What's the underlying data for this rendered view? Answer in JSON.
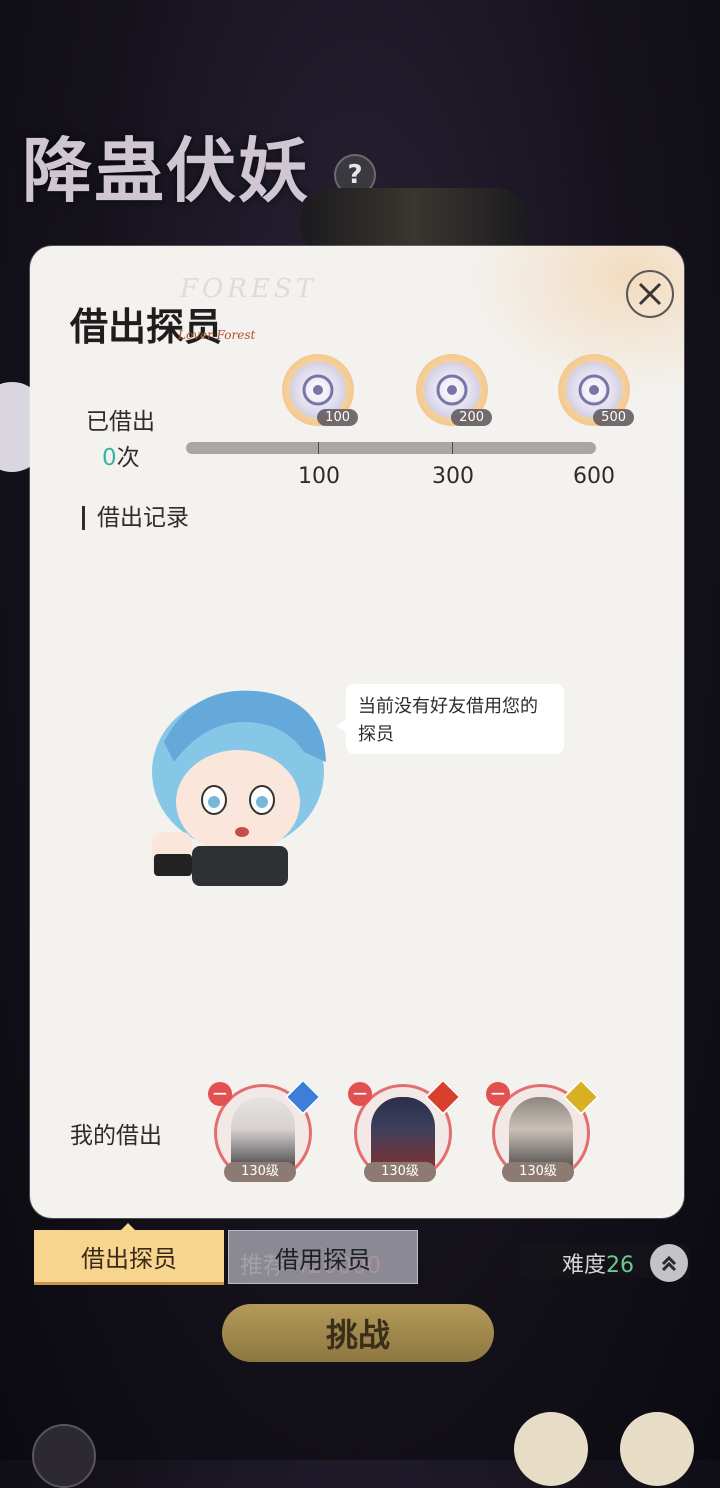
{
  "background": {
    "title": "降蛊伏妖",
    "help_icon": "?"
  },
  "panel": {
    "title": "借出探员",
    "watermark": "FOREST",
    "title_deco": "Lover Forest",
    "lent": {
      "label": "已借出",
      "count": "0",
      "unit": "次"
    },
    "rewards": [
      {
        "icon": "gear-coin-icon",
        "qty": "100"
      },
      {
        "icon": "gear-coin-icon",
        "qty": "200"
      },
      {
        "icon": "gear-coin-icon",
        "qty": "500"
      }
    ],
    "milestones": [
      "100",
      "300",
      "600"
    ],
    "progress": 0,
    "records_title": "借出记录",
    "empty_message": "当前没有好友借用您的探员",
    "my_lending_label": "我的借出",
    "agents": [
      {
        "level": "130级",
        "element_color": "#3d7fd8"
      },
      {
        "level": "130级",
        "element_color": "#d8402e"
      },
      {
        "level": "130级",
        "element_color": "#d9b024"
      }
    ]
  },
  "footer": {
    "tab_lend": "借出探员",
    "tab_borrow": "借用探员",
    "power_label": "推荐",
    "power_value": "420000",
    "difficulty_label": "难度",
    "difficulty_value": "26",
    "challenge_label": "挑战"
  }
}
